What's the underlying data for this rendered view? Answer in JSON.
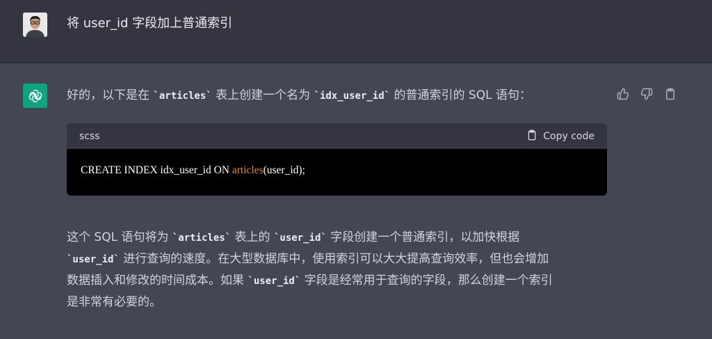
{
  "user_message": {
    "text": "将 user_id 字段加上普通索引"
  },
  "assistant": {
    "intro": {
      "before": "好的，以下是在 ",
      "code1": "`articles`",
      "mid": " 表上创建一个名为 ",
      "code2": "`idx_user_id`",
      "after": " 的普通索引的 SQL 语句："
    },
    "code_block": {
      "language": "scss",
      "copy_label": "Copy code",
      "code_before": "CREATE INDEX idx_user_id ON ",
      "code_highlight": "articles",
      "code_after": "(user_id);"
    },
    "explanation": {
      "l1_a": "这个 SQL 语句将为 ",
      "l1_code1": "`articles`",
      "l1_b": " 表上的 ",
      "l1_code2": "`user_id`",
      "l1_c": " 字段创建一个普通索引，以加快根据",
      "l2_code": "`user_id`",
      "l2_a": " 进行查询的速度。在大型数据库中，使用索引可以大大提高查询效率，但也会增加",
      "l3_a": "数据插入和修改的时间成本。如果 ",
      "l3_code": "`user_id`",
      "l3_b": " 字段是经常用于查询的字段，那么创建一个索引",
      "l4_a": "是非常有必要的。"
    }
  },
  "icons": {
    "thumbs_up": "thumbs-up-icon",
    "thumbs_down": "thumbs-down-icon",
    "clipboard": "clipboard-icon",
    "openai": "openai-logo-icon"
  },
  "colors": {
    "assistant_bg": "#444654",
    "user_bg": "#343541",
    "gpt_avatar": "#10a37f",
    "code_highlight": "#df8a3b"
  }
}
